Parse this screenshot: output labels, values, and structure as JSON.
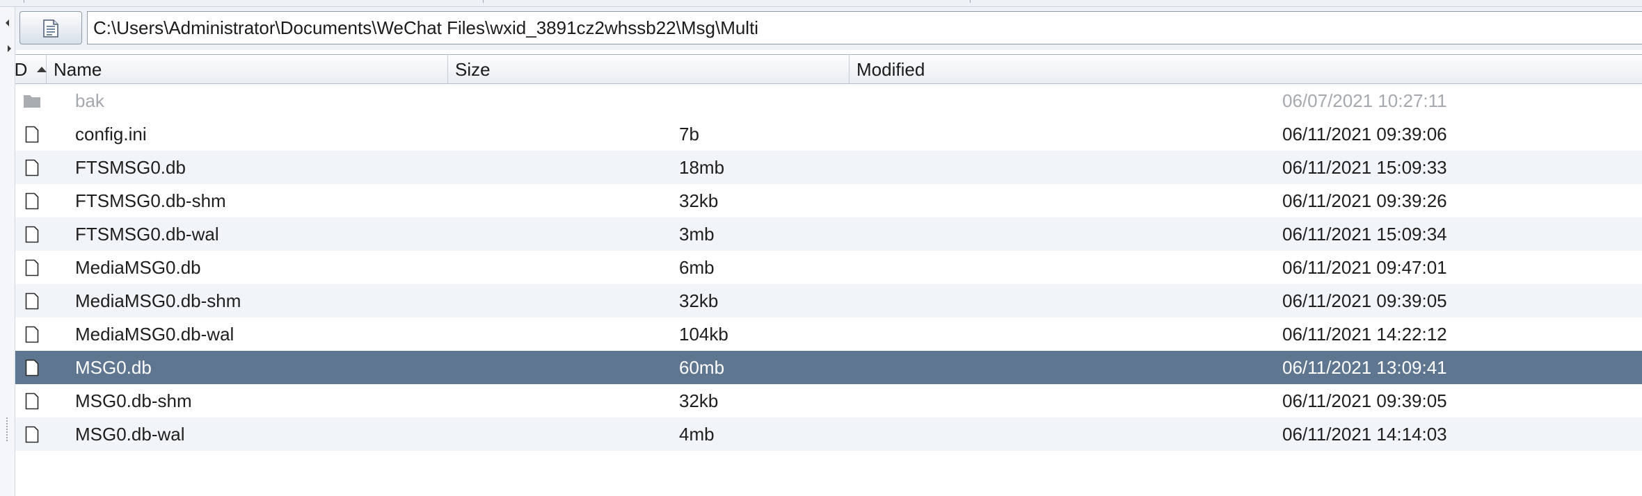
{
  "toolbar": {
    "doc_button_icon": "document-icon",
    "path": "C:\\Users\\Administrator\\Documents\\WeChat Files\\wxid_3891cz2whssb22\\Msg\\Multi"
  },
  "table": {
    "columns": {
      "d": "D",
      "name": "Name",
      "size": "Size",
      "modified": "Modified"
    },
    "sort": {
      "column": "D",
      "direction": "ascending"
    },
    "rows": [
      {
        "type": "folder",
        "name": "bak",
        "size": "",
        "modified": "06/07/2021 10:27:11"
      },
      {
        "type": "file",
        "name": "config.ini",
        "size": "7b",
        "modified": "06/11/2021 09:39:06"
      },
      {
        "type": "file",
        "name": "FTSMSG0.db",
        "size": "18mb",
        "modified": "06/11/2021 15:09:33"
      },
      {
        "type": "file",
        "name": "FTSMSG0.db-shm",
        "size": "32kb",
        "modified": "06/11/2021 09:39:26"
      },
      {
        "type": "file",
        "name": "FTSMSG0.db-wal",
        "size": "3mb",
        "modified": "06/11/2021 15:09:34"
      },
      {
        "type": "file",
        "name": "MediaMSG0.db",
        "size": "6mb",
        "modified": "06/11/2021 09:47:01"
      },
      {
        "type": "file",
        "name": "MediaMSG0.db-shm",
        "size": "32kb",
        "modified": "06/11/2021 09:39:05"
      },
      {
        "type": "file",
        "name": "MediaMSG0.db-wal",
        "size": "104kb",
        "modified": "06/11/2021 14:22:12"
      },
      {
        "type": "file",
        "name": "MSG0.db",
        "size": "60mb",
        "modified": "06/11/2021 13:09:41"
      },
      {
        "type": "file",
        "name": "MSG0.db-shm",
        "size": "32kb",
        "modified": "06/11/2021 09:39:05"
      },
      {
        "type": "file",
        "name": "MSG0.db-wal",
        "size": "4mb",
        "modified": "06/11/2021 14:14:03"
      }
    ]
  },
  "colors": {
    "selection": "#5f7691",
    "row_alt": "#f1f4f8",
    "folder": "#a9adb2",
    "chrome": "#eef1f5"
  }
}
